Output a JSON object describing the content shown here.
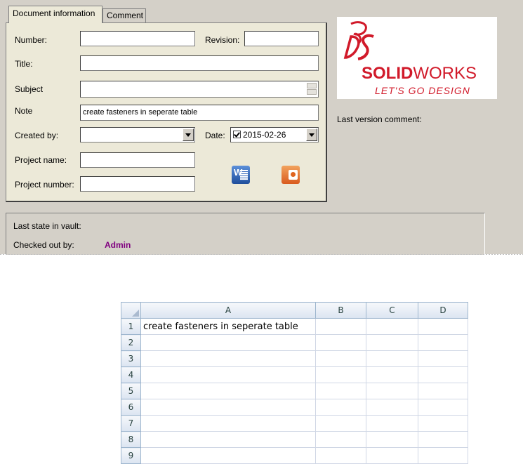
{
  "tabs": [
    {
      "label": "Document information",
      "active": true
    },
    {
      "label": "Comment",
      "active": false
    }
  ],
  "form": {
    "number_label": "Number:",
    "number_value": "",
    "revision_label": "Revision:",
    "revision_value": "",
    "title_label": "Title:",
    "title_value": "",
    "subject_label": "Subject",
    "subject_value": "",
    "note_label": "Note",
    "note_value": "create fasteners in seperate table",
    "created_by_label": "Created by:",
    "created_by_value": "",
    "date_label": "Date:",
    "date_value": "2015-02-26",
    "date_checked": true,
    "project_name_label": "Project name:",
    "project_name_value": "",
    "project_number_label": "Project number:",
    "project_number_value": ""
  },
  "icons": [
    "word-icon",
    "powerpoint-icon"
  ],
  "logo": {
    "brand_bold": "SOLID",
    "brand_light": "WORKS",
    "tagline": "LET'S GO DESIGN",
    "color": "#d11a2a"
  },
  "last_version_comment_label": "Last version comment:",
  "vault": {
    "last_state_label": "Last state in vault:",
    "checked_out_label": "Checked out by:",
    "checked_out_value": "Admin",
    "checked_out_color": "#800080"
  },
  "spreadsheet": {
    "columns": [
      "A",
      "B",
      "C",
      "D"
    ],
    "rows": [
      {
        "num": "1",
        "A": "create fasteners in seperate table"
      },
      {
        "num": "2",
        "A": ""
      },
      {
        "num": "3",
        "A": ""
      },
      {
        "num": "4",
        "A": ""
      },
      {
        "num": "5",
        "A": ""
      },
      {
        "num": "6",
        "A": ""
      },
      {
        "num": "7",
        "A": ""
      },
      {
        "num": "8",
        "A": ""
      },
      {
        "num": "9",
        "A": ""
      }
    ]
  }
}
